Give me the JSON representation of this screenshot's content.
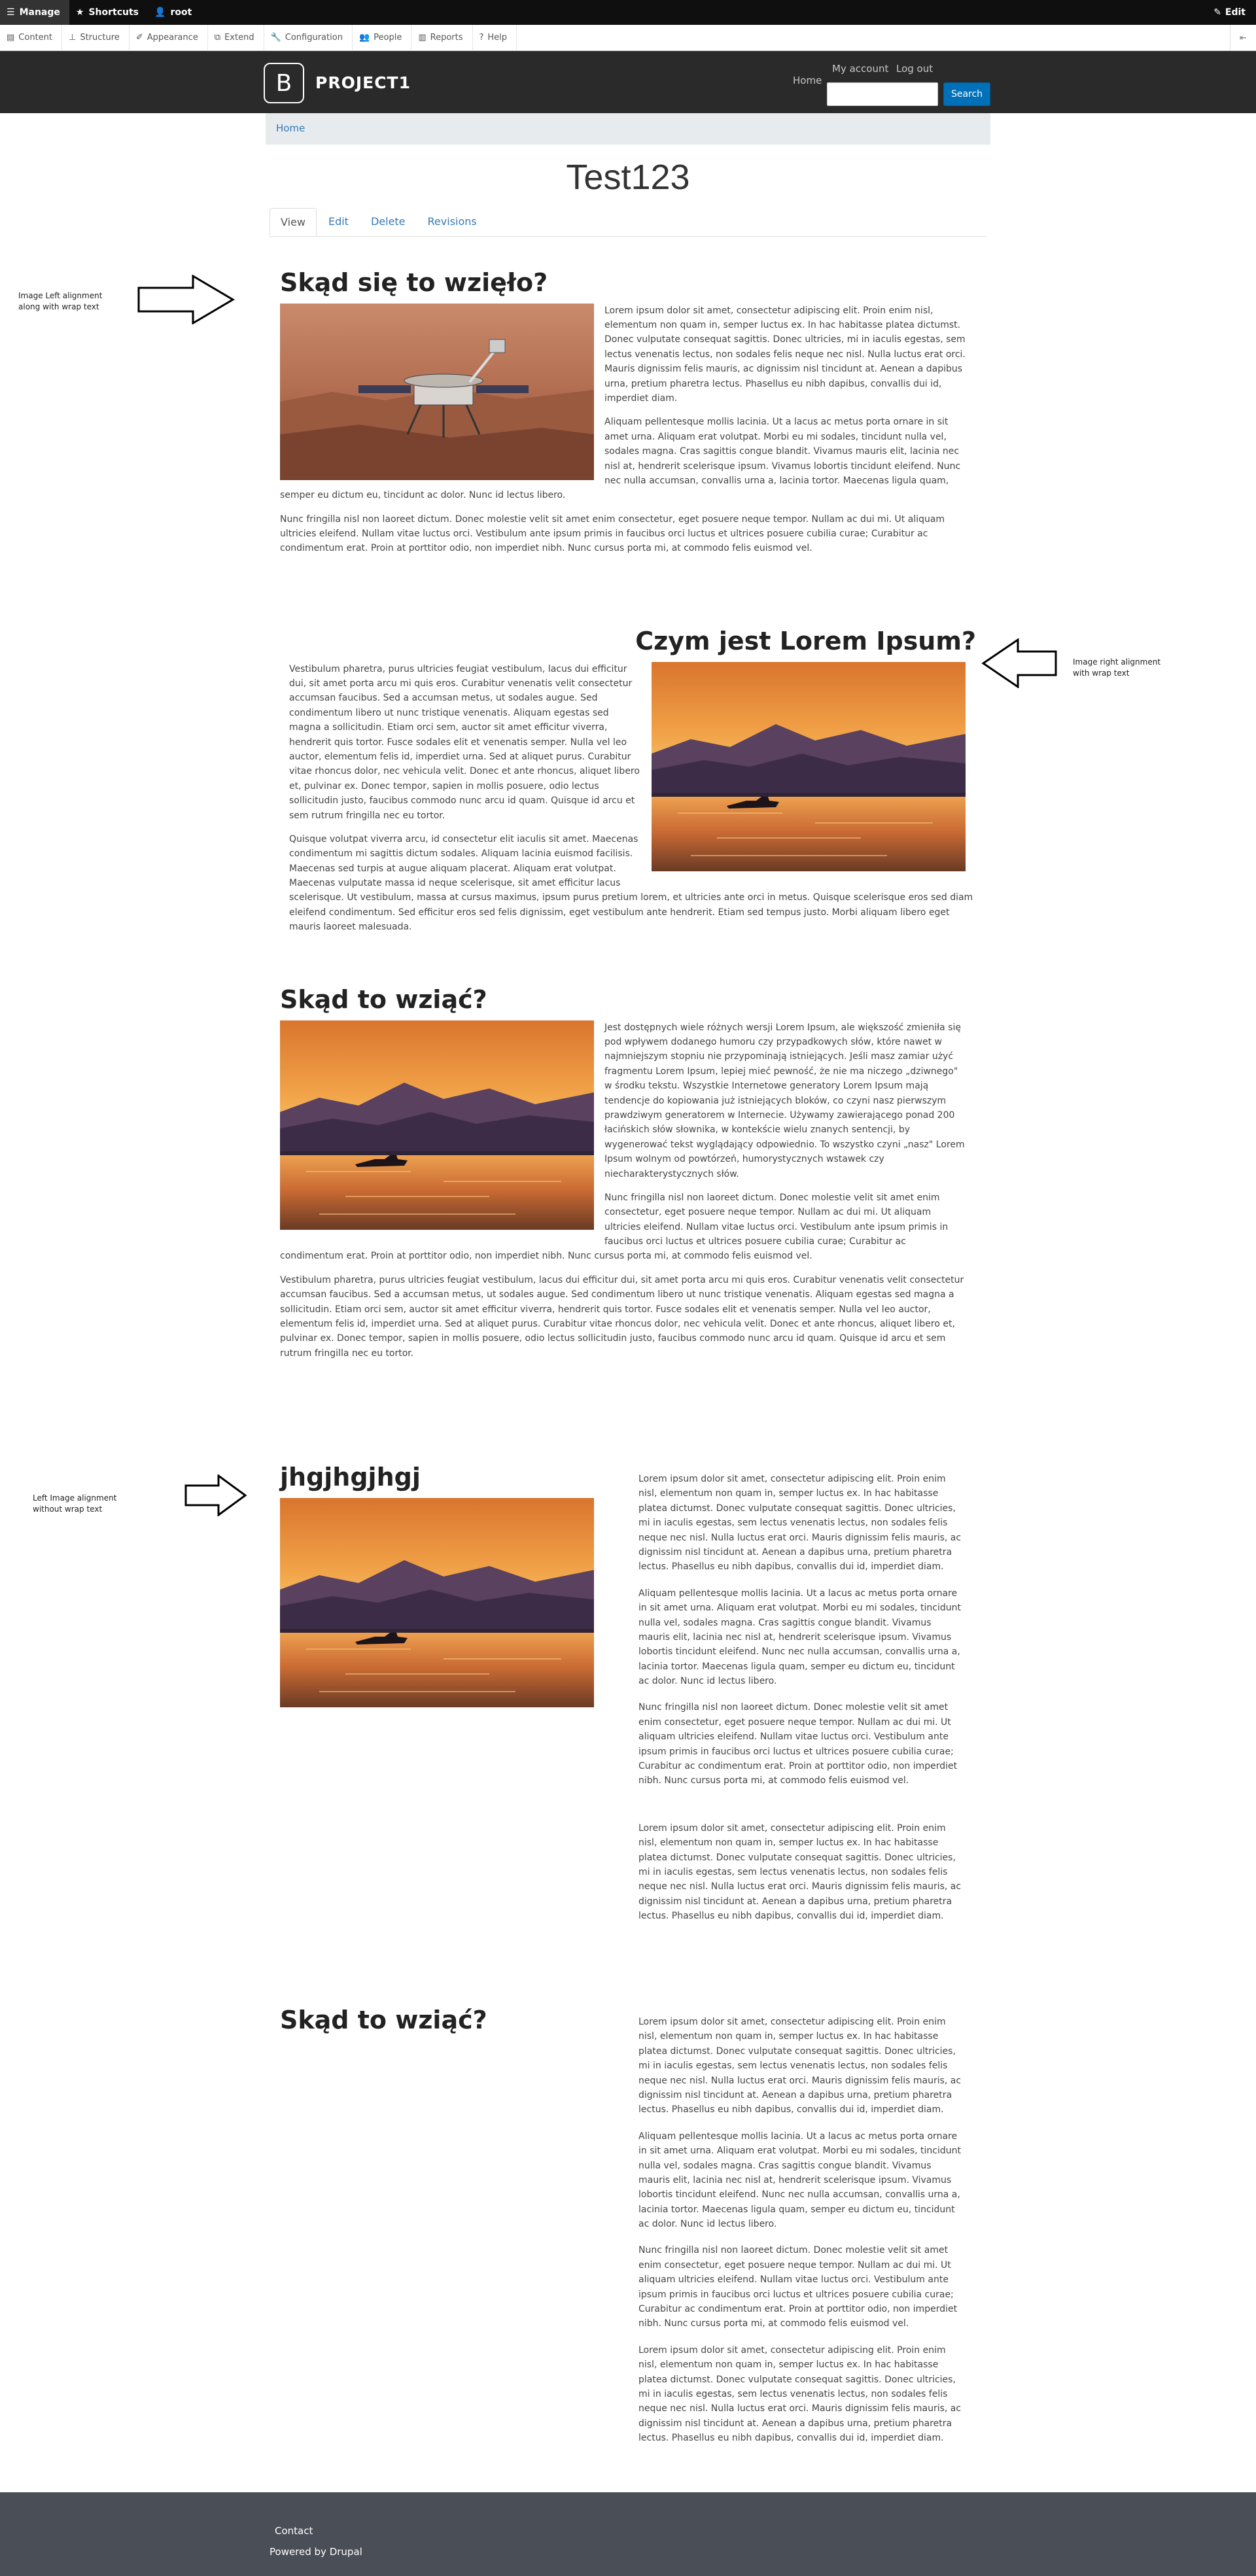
{
  "toolbar": {
    "manage": "Manage",
    "shortcuts": "Shortcuts",
    "user": "root",
    "edit": "Edit"
  },
  "tray": {
    "items": [
      "Content",
      "Structure",
      "Appearance",
      "Extend",
      "Configuration",
      "People",
      "Reports",
      "Help"
    ]
  },
  "header": {
    "logo_letter": "B",
    "site_name": "PROJECT1",
    "nav_home": "Home",
    "my_account": "My account",
    "log_out": "Log out",
    "search_placeholder": "",
    "search_button": "Search"
  },
  "breadcrumb": "Home",
  "page_title": "Test123",
  "tabs": [
    "View",
    "Edit",
    "Delete",
    "Revisions"
  ],
  "sections": {
    "s1": {
      "title": "Skąd się to wzięło?",
      "annotation": "Image Left alignment along with wrap text",
      "p1": "Lorem ipsum dolor sit amet, consectetur adipiscing elit. Proin enim nisl, elementum non quam in, semper luctus ex. In hac habitasse platea dictumst. Donec vulputate consequat sagittis. Donec ultricies, mi in iaculis egestas, sem lectus venenatis lectus, non sodales felis neque nec nisl. Nulla luctus erat orci. Mauris dignissim felis mauris, ac dignissim nisl tincidunt at. Aenean a dapibus urna, pretium pharetra lectus. Phasellus eu nibh dapibus, convallis dui id, imperdiet diam.",
      "p2": "Aliquam pellentesque mollis lacinia. Ut a lacus ac metus porta ornare in sit amet urna. Aliquam erat volutpat. Morbi eu mi sodales, tincidunt nulla vel, sodales magna. Cras sagittis congue blandit. Vivamus mauris elit, lacinia nec nisl at, hendrerit scelerisque ipsum. Vivamus lobortis tincidunt eleifend. Nunc nec nulla accumsan, convallis urna a, lacinia tortor. Maecenas ligula quam, semper eu dictum eu, tincidunt ac dolor. Nunc id lectus libero.",
      "p3": "Nunc fringilla nisl non laoreet dictum. Donec molestie velit sit amet enim consectetur, eget posuere neque tempor. Nullam ac dui mi. Ut aliquam ultricies eleifend. Nullam vitae luctus orci. Vestibulum ante ipsum primis in faucibus orci luctus et ultrices posuere cubilia curae; Curabitur ac condimentum erat. Proin at porttitor odio, non imperdiet nibh. Nunc cursus porta mi, at commodo felis euismod vel."
    },
    "s2": {
      "title": "Czym jest Lorem Ipsum?",
      "annotation": "Image right alignment with wrap text",
      "p1": "Vestibulum pharetra, purus ultricies feugiat vestibulum, lacus dui efficitur dui, sit amet porta arcu mi quis eros. Curabitur venenatis velit consectetur accumsan faucibus. Sed a accumsan metus, ut sodales augue. Sed condimentum libero ut nunc tristique venenatis. Aliquam egestas sed magna a sollicitudin. Etiam orci sem, auctor sit amet efficitur viverra, hendrerit quis tortor. Fusce sodales elit et venenatis semper. Nulla vel leo auctor, elementum felis id, imperdiet urna. Sed at aliquet purus. Curabitur vitae rhoncus dolor, nec vehicula velit. Donec et ante rhoncus, aliquet libero et, pulvinar ex. Donec tempor, sapien in mollis posuere, odio lectus sollicitudin justo, faucibus commodo nunc arcu id quam. Quisque id arcu et sem rutrum fringilla nec eu tortor.",
      "p2": "Quisque volutpat viverra arcu, id consectetur elit iaculis sit amet. Maecenas condimentum mi sagittis dictum sodales. Aliquam lacinia euismod facilisis. Maecenas sed turpis at augue aliquam placerat. Aliquam erat volutpat. Maecenas vulputate massa id neque scelerisque, sit amet efficitur lacus scelerisque. Ut vestibulum, massa at cursus maximus, ipsum purus pretium lorem, et ultricies ante orci in metus. Quisque scelerisque eros sed diam eleifend condimentum. Sed efficitur eros sed felis dignissim, eget vestibulum ante hendrerit. Etiam sed tempus justo. Morbi aliquam libero eget mauris laoreet malesuada."
    },
    "s3": {
      "title": "Skąd to wziąć?",
      "p1": "Jest dostępnych wiele różnych wersji Lorem Ipsum, ale większość zmieniła się pod wpływem dodanego humoru czy przypadkowych słów, które nawet w najmniejszym stopniu nie przypominają istniejących. Jeśli masz zamiar użyć fragmentu Lorem Ipsum, lepiej mieć pewność, że nie ma niczego „dziwnego\" w środku tekstu. Wszystkie Internetowe generatory Lorem Ipsum mają tendencje do kopiowania już istniejących bloków, co czyni nasz pierwszym prawdziwym generatorem w Internecie. Używamy zawierającego ponad 200 łacińskich słów słownika, w kontekście wielu znanych sentencji, by wygenerować tekst wyglądający odpowiednio. To wszystko czyni „nasz\" Lorem Ipsum wolnym od powtórzeń, humorystycznych wstawek czy niecharakterystycznych słów.",
      "p2": "Nunc fringilla nisl non laoreet dictum. Donec molestie velit sit amet enim consectetur, eget posuere neque tempor. Nullam ac dui mi. Ut aliquam ultricies eleifend. Nullam vitae luctus orci. Vestibulum ante ipsum primis in faucibus orci luctus et ultrices posuere cubilia curae; Curabitur ac condimentum erat. Proin at porttitor odio, non imperdiet nibh. Nunc cursus porta mi, at commodo felis euismod vel.",
      "p3": "Vestibulum pharetra, purus ultricies feugiat vestibulum, lacus dui efficitur dui, sit amet porta arcu mi quis eros. Curabitur venenatis velit consectetur accumsan faucibus. Sed a accumsan metus, ut sodales augue. Sed condimentum libero ut nunc tristique venenatis. Aliquam egestas sed magna a sollicitudin. Etiam orci sem, auctor sit amet efficitur viverra, hendrerit quis tortor. Fusce sodales elit et venenatis semper. Nulla vel leo auctor, elementum felis id, imperdiet urna. Sed at aliquet purus. Curabitur vitae rhoncus dolor, nec vehicula velit. Donec et ante rhoncus, aliquet libero et, pulvinar ex. Donec tempor, sapien in mollis posuere, odio lectus sollicitudin justo, faucibus commodo nunc arcu id quam. Quisque id arcu et sem rutrum fringilla nec eu tortor."
    },
    "s4": {
      "title": "jhgjhgjhgj",
      "annotation": "Left Image alignment without wrap text",
      "p1": "Lorem ipsum dolor sit amet, consectetur adipiscing elit. Proin enim nisl, elementum non quam in, semper luctus ex. In hac habitasse platea dictumst. Donec vulputate consequat sagittis. Donec ultricies, mi in iaculis egestas, sem lectus venenatis lectus, non sodales felis neque nec nisl. Nulla luctus erat orci. Mauris dignissim felis mauris, ac dignissim nisl tincidunt at. Aenean a dapibus urna, pretium pharetra lectus. Phasellus eu nibh dapibus, convallis dui id, imperdiet diam.",
      "p2": "Aliquam pellentesque mollis lacinia. Ut a lacus ac metus porta ornare in sit amet urna. Aliquam erat volutpat. Morbi eu mi sodales, tincidunt nulla vel, sodales magna. Cras sagittis congue blandit. Vivamus mauris elit, lacinia nec nisl at, hendrerit scelerisque ipsum. Vivamus lobortis tincidunt eleifend. Nunc nec nulla accumsan, convallis urna a, lacinia tortor. Maecenas ligula quam, semper eu dictum eu, tincidunt ac dolor. Nunc id lectus libero.",
      "p3": "Nunc fringilla nisl non laoreet dictum. Donec molestie velit sit amet enim consectetur, eget posuere neque tempor. Nullam ac dui mi. Ut aliquam ultricies eleifend. Nullam vitae luctus orci. Vestibulum ante ipsum primis in faucibus orci luctus et ultrices posuere cubilia curae; Curabitur ac condimentum erat. Proin at porttitor odio, non imperdiet nibh. Nunc cursus porta mi, at commodo felis euismod vel.",
      "p4": "Lorem ipsum dolor sit amet, consectetur adipiscing elit. Proin enim nisl, elementum non quam in, semper luctus ex. In hac habitasse platea dictumst. Donec vulputate consequat sagittis. Donec ultricies, mi in iaculis egestas, sem lectus venenatis lectus, non sodales felis neque nec nisl. Nulla luctus erat orci. Mauris dignissim felis mauris, ac dignissim nisl tincidunt at. Aenean a dapibus urna, pretium pharetra lectus. Phasellus eu nibh dapibus, convallis dui id, imperdiet diam."
    },
    "s5": {
      "title": "Skąd to wziąć?",
      "p1": "Lorem ipsum dolor sit amet, consectetur adipiscing elit. Proin enim nisl, elementum non quam in, semper luctus ex. In hac habitasse platea dictumst. Donec vulputate consequat sagittis. Donec ultricies, mi in iaculis egestas, sem lectus venenatis lectus, non sodales felis neque nec nisl. Nulla luctus erat orci. Mauris dignissim felis mauris, ac dignissim nisl tincidunt at. Aenean a dapibus urna, pretium pharetra lectus. Phasellus eu nibh dapibus, convallis dui id, imperdiet diam.",
      "p2": "Aliquam pellentesque mollis lacinia. Ut a lacus ac metus porta ornare in sit amet urna. Aliquam erat volutpat. Morbi eu mi sodales, tincidunt nulla vel, sodales magna. Cras sagittis congue blandit. Vivamus mauris elit, lacinia nec nisl at, hendrerit scelerisque ipsum. Vivamus lobortis tincidunt eleifend. Nunc nec nulla accumsan, convallis urna a, lacinia tortor. Maecenas ligula quam, semper eu dictum eu, tincidunt ac dolor. Nunc id lectus libero.",
      "p3": "Nunc fringilla nisl non laoreet dictum. Donec molestie velit sit amet enim consectetur, eget posuere neque tempor. Nullam ac dui mi. Ut aliquam ultricies eleifend. Nullam vitae luctus orci. Vestibulum ante ipsum primis in faucibus orci luctus et ultrices posuere cubilia curae; Curabitur ac condimentum erat. Proin at porttitor odio, non imperdiet nibh. Nunc cursus porta mi, at commodo felis euismod vel.",
      "p4": "Lorem ipsum dolor sit amet, consectetur adipiscing elit. Proin enim nisl, elementum non quam in, semper luctus ex. In hac habitasse platea dictumst. Donec vulputate consequat sagittis. Donec ultricies, mi in iaculis egestas, sem lectus venenatis lectus, non sodales felis neque nec nisl. Nulla luctus erat orci. Mauris dignissim felis mauris, ac dignissim nisl tincidunt at. Aenean a dapibus urna, pretium pharetra lectus. Phasellus eu nibh dapibus, convallis dui id, imperdiet diam."
    }
  },
  "footer": {
    "contact": "Contact",
    "powered_by": "Powered by Drupal"
  },
  "colors": {
    "toolbar_bg": "#0f0f0f",
    "header_bg": "#2a2a2a",
    "link": "#337ab7",
    "search_button": "#0071b8",
    "footer_bg": "#4a4e57"
  }
}
